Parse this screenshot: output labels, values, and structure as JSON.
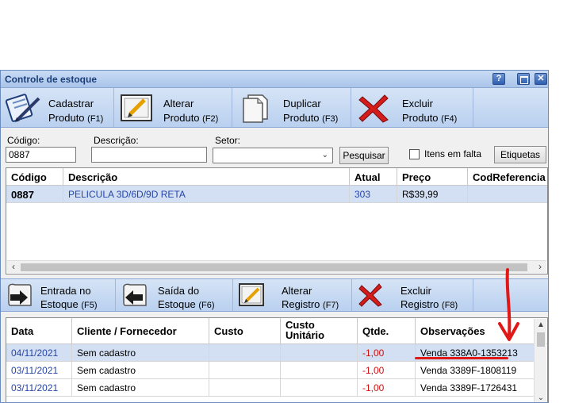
{
  "window": {
    "title": "Controle de estoque",
    "help_label": "?",
    "close_label": "✕"
  },
  "toolbar": [
    {
      "line1": "Cadastrar",
      "line2": "Produto",
      "key": "(F1)"
    },
    {
      "line1": "Alterar",
      "line2": "Produto",
      "key": "(F2)"
    },
    {
      "line1": "Duplicar",
      "line2": "Produto",
      "key": "(F3)"
    },
    {
      "line1": "Excluir",
      "line2": "Produto",
      "key": "(F4)"
    }
  ],
  "search": {
    "codigo_label": "Código:",
    "codigo_value": "0887",
    "descricao_label": "Descrição:",
    "descricao_value": "",
    "setor_label": "Setor:",
    "setor_value": "",
    "pesquisar_label": "Pesquisar",
    "itens_em_falta_label": "Itens em falta",
    "itens_em_falta_checked": false,
    "etiquetas_label": "Etiquetas"
  },
  "products": {
    "columns": [
      "Código",
      "Descrição",
      "Atual",
      "Preço",
      "CodReferencia"
    ],
    "rows": [
      {
        "codigo": "0887",
        "descricao": "PELICULA 3D/6D/9D RETA",
        "atual": "303",
        "preco": "R$39,99",
        "codref": ""
      }
    ]
  },
  "toolbar2": [
    {
      "line1": "Entrada no",
      "line2": "Estoque",
      "key": "(F5)"
    },
    {
      "line1": "Saída do",
      "line2": "Estoque",
      "key": "(F6)"
    },
    {
      "line1": "Alterar",
      "line2": "Registro",
      "key": "(F7)"
    },
    {
      "line1": "Excluir",
      "line2": "Registro",
      "key": "(F8)"
    }
  ],
  "movements": {
    "columns": [
      "Data",
      "Cliente / Fornecedor",
      "Custo",
      "Custo Unitário",
      "Qtde.",
      "Observações"
    ],
    "custo_unitario_l1": "Custo",
    "custo_unitario_l2": "Unitário",
    "rows": [
      {
        "data": "04/11/2021",
        "cliente": "Sem cadastro",
        "custo": "",
        "custo_unit": "",
        "qtde": "-1,00",
        "obs": "Venda 338A0-1353213"
      },
      {
        "data": "03/11/2021",
        "cliente": "Sem cadastro",
        "custo": "",
        "custo_unit": "",
        "qtde": "-1,00",
        "obs": "Venda 3389F-1808119"
      },
      {
        "data": "03/11/2021",
        "cliente": "Sem cadastro",
        "custo": "",
        "custo_unit": "",
        "qtde": "-1,00",
        "obs": "Venda 3389F-1726431"
      }
    ]
  },
  "colors": {
    "accent_blue": "#2545a8",
    "negative_red": "#d01010",
    "selected_row": "#d3e0f3",
    "annotation_red": "#e01818"
  }
}
